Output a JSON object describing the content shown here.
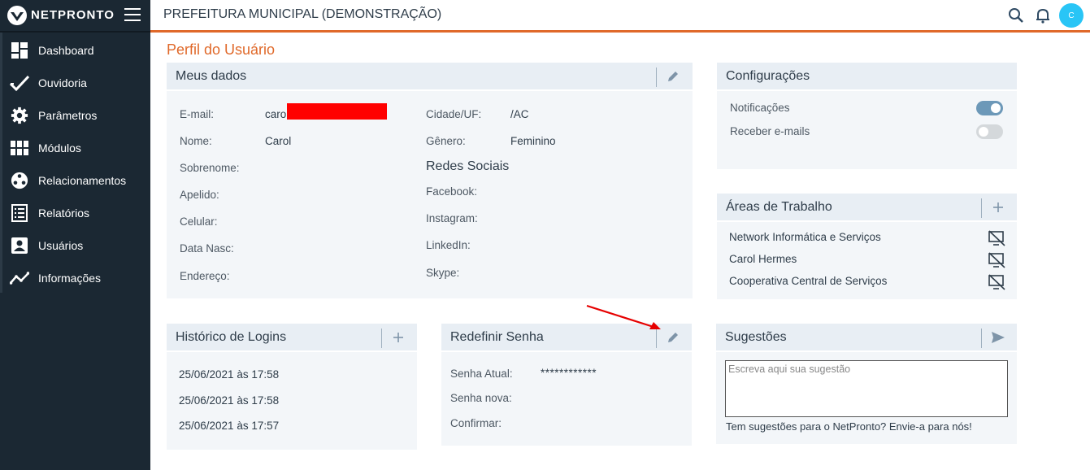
{
  "app": {
    "brand": "NETPRONTO",
    "org_title": "PREFEITURA MUNICIPAL (DEMONSTRAÇÃO)",
    "avatar_initial": "C",
    "accent_color": "#e0692a",
    "sidebar_color": "#1b2833"
  },
  "sidebar": {
    "items": [
      {
        "label": "Dashboard",
        "icon": "dashboard-icon"
      },
      {
        "label": "Ouvidoria",
        "icon": "check-icon"
      },
      {
        "label": "Parâmetros",
        "icon": "gear-icon"
      },
      {
        "label": "Módulos",
        "icon": "grid-icon"
      },
      {
        "label": "Relacionamentos",
        "icon": "network-icon"
      },
      {
        "label": "Relatórios",
        "icon": "list-icon"
      },
      {
        "label": "Usuários",
        "icon": "user-icon"
      },
      {
        "label": "Informações",
        "icon": "trend-icon"
      }
    ]
  },
  "page": {
    "title": "Perfil do Usuário"
  },
  "meus_dados": {
    "title": "Meus dados",
    "fields_left": [
      {
        "label": "E-mail:",
        "value": "caro"
      },
      {
        "label": "Nome:",
        "value": "Carol"
      },
      {
        "label": "Sobrenome:",
        "value": ""
      },
      {
        "label": "Apelido:",
        "value": ""
      },
      {
        "label": "Celular:",
        "value": ""
      },
      {
        "label": "Data Nasc:",
        "value": ""
      },
      {
        "label": "Endereço:",
        "value": ""
      }
    ],
    "fields_right": [
      {
        "label": "Cidade/UF:",
        "value": "/AC"
      },
      {
        "label": "Gênero:",
        "value": "Feminino"
      }
    ],
    "social_title": "Redes Sociais",
    "social": [
      {
        "label": "Facebook:",
        "value": ""
      },
      {
        "label": "Instagram:",
        "value": ""
      },
      {
        "label": "LinkedIn:",
        "value": ""
      },
      {
        "label": "Skype:",
        "value": ""
      }
    ]
  },
  "configuracoes": {
    "title": "Configurações",
    "toggles": [
      {
        "label": "Notificações",
        "on": true
      },
      {
        "label": "Receber e-mails",
        "on": false
      }
    ]
  },
  "areas": {
    "title": "Áreas de Trabalho",
    "items": [
      "Network Informática e Serviços",
      "Carol Hermes",
      "Cooperativa Central de Serviços"
    ]
  },
  "historico": {
    "title": "Histórico de Logins",
    "entries": [
      "25/06/2021 às 17:58",
      "25/06/2021 às 17:58",
      "25/06/2021 às 17:57"
    ]
  },
  "senha": {
    "title": "Redefinir Senha",
    "fields": [
      {
        "label": "Senha Atual:",
        "value": "************"
      },
      {
        "label": "Senha nova:",
        "value": ""
      },
      {
        "label": "Confirmar:",
        "value": ""
      }
    ]
  },
  "sugestoes": {
    "title": "Sugestões",
    "placeholder": "Escreva aqui sua sugestão",
    "footer": "Tem sugestões para o NetPronto? Envie-a para nós!"
  }
}
